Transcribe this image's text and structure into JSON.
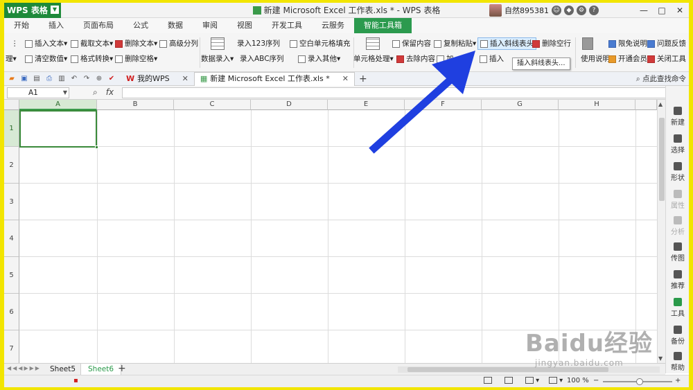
{
  "window": {
    "app_menu_label": "WPS 表格",
    "title": "新建 Microsoft Excel 工作表.xls * - WPS 表格",
    "user_name": "自然895381",
    "controls": [
      "?",
      "—",
      "□",
      "✕"
    ]
  },
  "menu_tabs": [
    "开始",
    "插入",
    "页面布局",
    "公式",
    "数据",
    "审阅",
    "视图",
    "开发工具",
    "云服务",
    "智能工具箱"
  ],
  "active_menu_tab": "智能工具箱",
  "ribbon": {
    "row1": [
      "插入文本",
      "截取文本",
      "删除文本",
      "高级分列",
      "录入123序列",
      "空白单元格填充",
      "保留内容",
      "复制粘贴",
      "插入斜线表头",
      "删除空行",
      "限免说明",
      "问题反馈"
    ],
    "row2": [
      "理",
      "清空数值",
      "格式转换",
      "删除空格",
      "数据录入",
      "录入ABC序列",
      "录入其他",
      "单元格处理",
      "去除内容",
      "加",
      "插入",
      "使用说明",
      "开通会员",
      "关闭工具"
    ],
    "tooltip": "插入斜线表头..."
  },
  "doc_tabs": [
    {
      "label": "我的WPS",
      "active": false
    },
    {
      "label": "新建 Microsoft Excel 工作表.xls *",
      "active": true
    }
  ],
  "search_command": "点此查找命令",
  "formula_bar": {
    "name_box": "A1",
    "fx_label": "fx",
    "value": ""
  },
  "grid": {
    "columns": [
      "A",
      "B",
      "C",
      "D",
      "E",
      "F",
      "G",
      "H"
    ],
    "rows": [
      "1",
      "2",
      "3",
      "4",
      "5",
      "6",
      "7"
    ],
    "selected_cell": "A1"
  },
  "right_panel": [
    {
      "label": "新建",
      "enabled": true
    },
    {
      "label": "选择",
      "enabled": true
    },
    {
      "label": "形状",
      "enabled": true
    },
    {
      "label": "属性",
      "enabled": false
    },
    {
      "label": "分析",
      "enabled": false
    },
    {
      "label": "传图",
      "enabled": true
    },
    {
      "label": "推荐",
      "enabled": true
    },
    {
      "label": "工具",
      "enabled": true
    },
    {
      "label": "备份",
      "enabled": true
    },
    {
      "label": "帮助",
      "enabled": true
    }
  ],
  "sheets": [
    {
      "label": "Sheet5",
      "active": false
    },
    {
      "label": "Sheet6",
      "active": true
    }
  ],
  "status": {
    "zoom": "100 %"
  },
  "watermark": {
    "main": "Baidu经验",
    "sub": "jingyan.baidu.com"
  },
  "colors": {
    "accent": "#2b9a4e",
    "arrow": "#1f3fe0",
    "frame": "#f2e500",
    "selection": "#3a8a3a"
  }
}
